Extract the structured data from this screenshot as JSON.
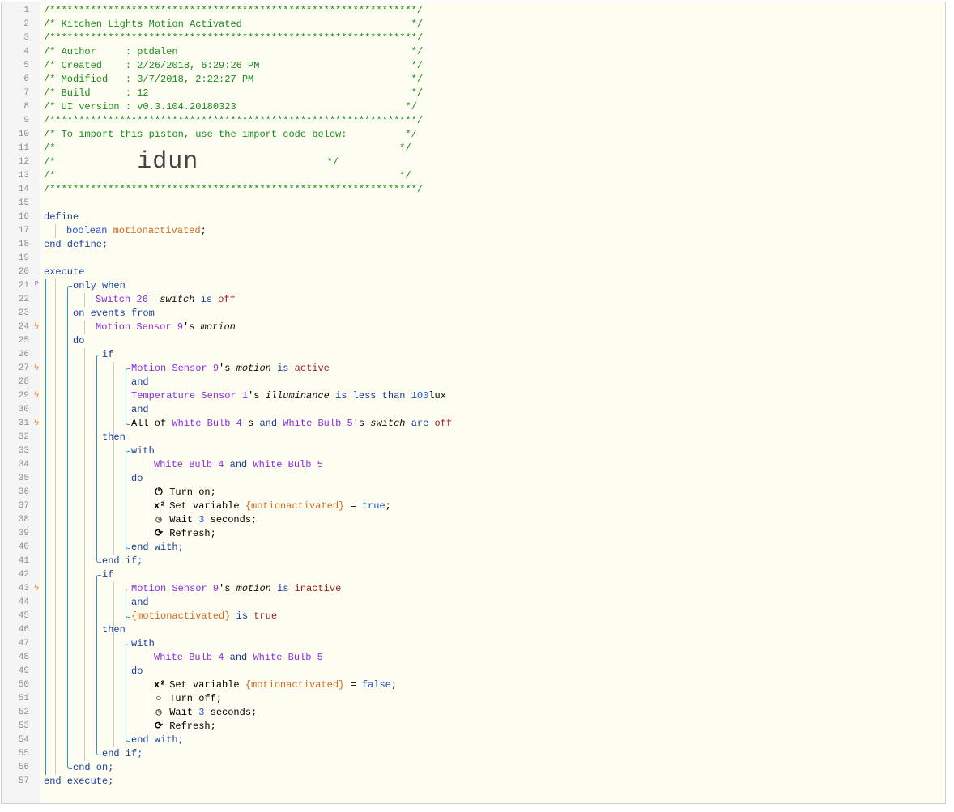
{
  "editor": {
    "lines": [
      "1",
      "2",
      "3",
      "4",
      "5",
      "6",
      "7",
      "8",
      "9",
      "10",
      "11",
      "12",
      "13",
      "14",
      "15",
      "16",
      "17",
      "18",
      "19",
      "20",
      "21",
      "22",
      "23",
      "24",
      "25",
      "26",
      "27",
      "28",
      "29",
      "30",
      "31",
      "32",
      "33",
      "34",
      "35",
      "36",
      "37",
      "38",
      "39",
      "40",
      "41",
      "42",
      "43",
      "44",
      "45",
      "46",
      "47",
      "48",
      "49",
      "50",
      "51",
      "52",
      "53",
      "54",
      "55",
      "56",
      "57"
    ],
    "header": {
      "rule": "/***************************************************************/",
      "title": "/* Kitchen Lights Motion Activated                             */",
      "author": "/* Author     : ptdalen                                        */",
      "created": "/* Created    : 2/26/2018, 6:29:26 PM                          */",
      "modified": "/* Modified   : 3/7/2018, 2:22:27 PM                           */",
      "build": "/* Build      : 12                                             */",
      "ui_version": "/* UI version : v0.3.104.20180323                             */",
      "import_note": "/* To import this piston, use the import code below:          */",
      "blank_comment": "/*                                                           */",
      "code_prefix": "/*              ",
      "code_suffix": "                      */",
      "import_code": "idun"
    },
    "kw": {
      "define": "define",
      "end_define": "end define;",
      "execute": "execute",
      "end_execute": "end execute;",
      "only_when": "only when",
      "on_events_from": "on events from",
      "do": "do",
      "end_on": "end on;",
      "if": "if",
      "then": "then",
      "end_if": "end if;",
      "with": "with",
      "end_with": "end with;",
      "and": "and",
      "is": "is",
      "are": "are",
      "is_less_than": "is less than",
      "all_of": "All of",
      "possessive": "'s",
      "possessive_alt": "' ",
      "semicolon": ";",
      "equals": "=",
      "set_variable": "Set variable",
      "turn_on": "Turn on;",
      "turn_off": "Turn off;",
      "wait": "Wait",
      "seconds": "seconds;",
      "refresh": "Refresh;"
    },
    "type_boolean": "boolean",
    "var_name": "motionactivated",
    "var_ref": "{motionactivated}",
    "devices": {
      "switch26": "Switch 26",
      "motion9": "Motion Sensor 9",
      "temp1": "Temperature Sensor 1",
      "bulb4": "White Bulb 4",
      "bulb5": "White Bulb 5"
    },
    "attrs": {
      "switch": "switch",
      "motion": "motion",
      "illuminance": "illuminance"
    },
    "values": {
      "off": "off",
      "active": "active",
      "inactive": "inactive",
      "true": "true",
      "false": "false",
      "lux_num": "100",
      "lux_unit": "lux",
      "wait_seconds": "3"
    },
    "icons": {
      "power": "⏻",
      "x2": "x²",
      "clock": "◷",
      "refresh": "⟳",
      "circle": "○",
      "bolt": "ϟ",
      "cond": "ᴾ"
    }
  }
}
